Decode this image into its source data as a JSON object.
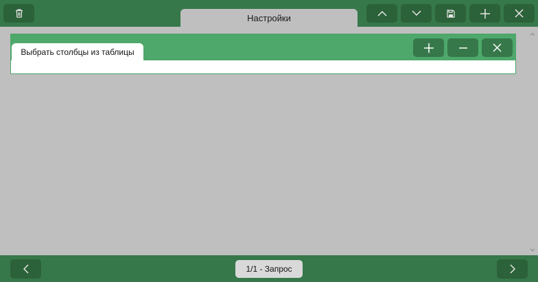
{
  "header": {
    "tab_title": "Настройки",
    "icons": {
      "delete": "trash-icon",
      "move_up": "chevron-up-icon",
      "move_down": "chevron-down-icon",
      "save": "save-icon",
      "add": "plus-icon",
      "close": "close-icon"
    }
  },
  "panel": {
    "tab_title": "Выбрать столбцы из таблицы",
    "icons": {
      "add": "plus-icon",
      "remove": "minus-icon",
      "close": "close-icon"
    }
  },
  "footer": {
    "page_indicator": "1/1 - Запрос",
    "icons": {
      "prev": "chevron-left-icon",
      "next": "chevron-right-icon"
    }
  },
  "colors": {
    "topbar": "#36784a",
    "button": "#2c6239",
    "panel_header": "#4ea86b",
    "background": "#bfbfbf"
  }
}
